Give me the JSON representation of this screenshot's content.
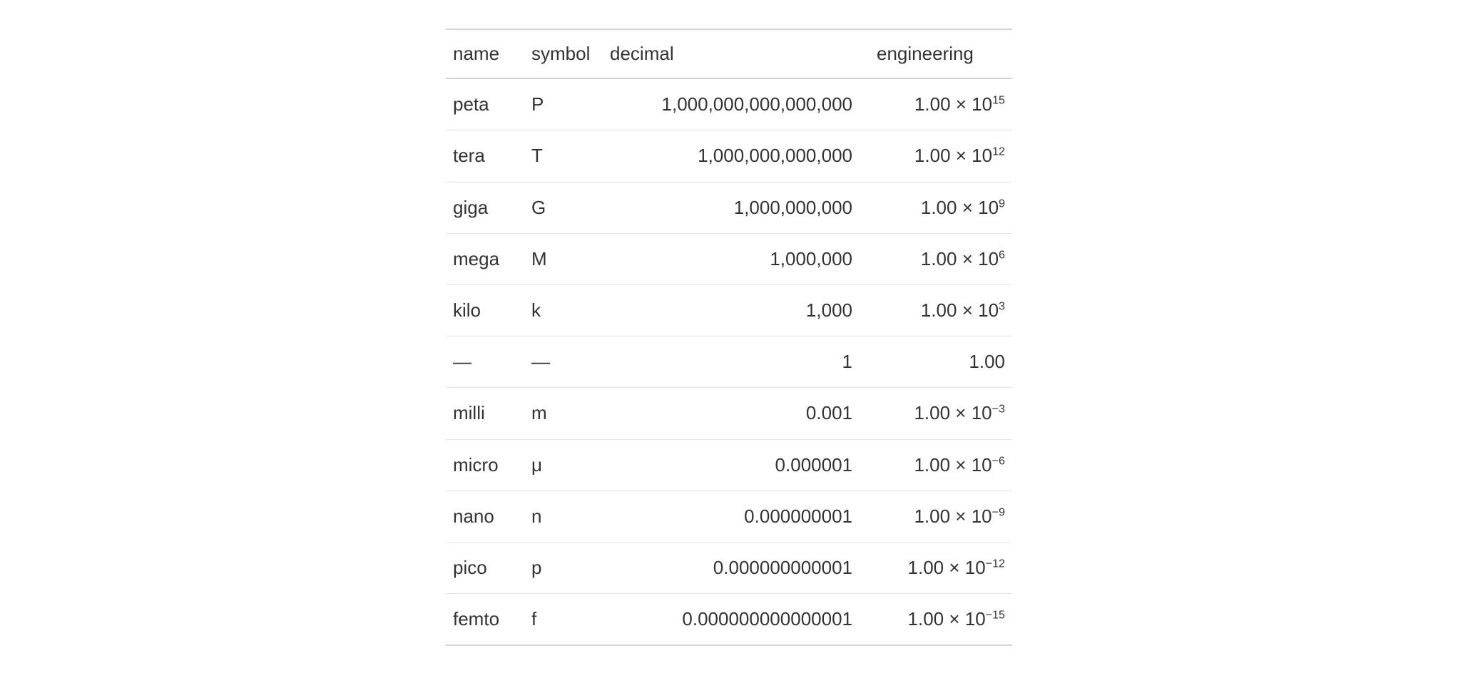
{
  "table": {
    "headers": {
      "name": "name",
      "symbol": "symbol",
      "decimal": "decimal",
      "engineering": "engineering"
    },
    "rows": [
      {
        "name": "peta",
        "symbol": "P",
        "decimal": "1,000,000,000,000,000",
        "eng_base": "1.00 × 10",
        "eng_exp": "15"
      },
      {
        "name": "tera",
        "symbol": "T",
        "decimal": "1,000,000,000,000",
        "eng_base": "1.00 × 10",
        "eng_exp": "12"
      },
      {
        "name": "giga",
        "symbol": "G",
        "decimal": "1,000,000,000",
        "eng_base": "1.00 × 10",
        "eng_exp": "9"
      },
      {
        "name": "mega",
        "symbol": "M",
        "decimal": "1,000,000",
        "eng_base": "1.00 × 10",
        "eng_exp": "6"
      },
      {
        "name": "kilo",
        "symbol": "k",
        "decimal": "1,000",
        "eng_base": "1.00 × 10",
        "eng_exp": "3"
      },
      {
        "name": "—",
        "symbol": "—",
        "decimal": "1",
        "eng_base": "1.00",
        "eng_exp": ""
      },
      {
        "name": "milli",
        "symbol": "m",
        "decimal": "0.001",
        "eng_base": "1.00 × 10",
        "eng_exp": "−3"
      },
      {
        "name": "micro",
        "symbol": "μ",
        "decimal": "0.000001",
        "eng_base": "1.00 × 10",
        "eng_exp": "−6"
      },
      {
        "name": "nano",
        "symbol": "n",
        "decimal": "0.000000001",
        "eng_base": "1.00 × 10",
        "eng_exp": "−9"
      },
      {
        "name": "pico",
        "symbol": "p",
        "decimal": "0.000000000001",
        "eng_base": "1.00 × 10",
        "eng_exp": "−12"
      },
      {
        "name": "femto",
        "symbol": "f",
        "decimal": "0.000000000000001",
        "eng_base": "1.00 × 10",
        "eng_exp": "−15"
      }
    ]
  }
}
